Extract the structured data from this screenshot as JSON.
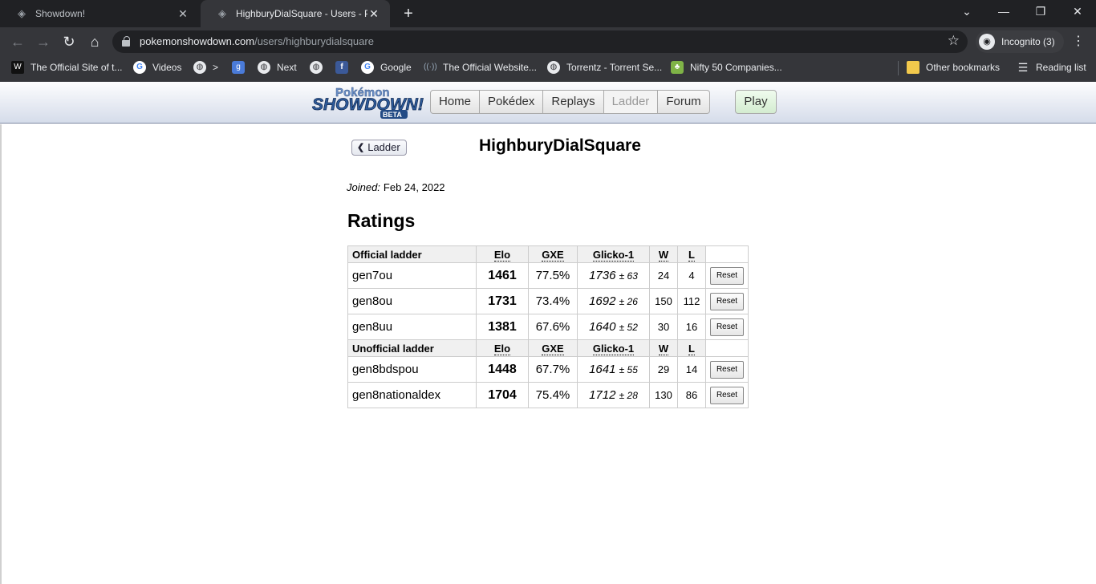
{
  "browser": {
    "tabs": [
      {
        "title": "Showdown!"
      },
      {
        "title": "HighburyDialSquare - Users - Pok"
      }
    ],
    "url_host": "pokemonshowdown.com",
    "url_path": "/users/highburydialsquare",
    "incognito_label": "Incognito (3)",
    "bookmarks": [
      {
        "label": "The Official Site of t...",
        "icon": "wwe-icon"
      },
      {
        "label": "Videos",
        "icon": "google-icon"
      },
      {
        "label": ">",
        "icon": "globe-icon"
      },
      {
        "label": "",
        "icon": "gs-icon"
      },
      {
        "label": "Next",
        "icon": "globe-icon"
      },
      {
        "label": "",
        "icon": "globe-icon"
      },
      {
        "label": "",
        "icon": "facebook-icon"
      },
      {
        "label": "Google",
        "icon": "google-icon"
      },
      {
        "label": "The Official Website...",
        "icon": "broadcast-icon"
      },
      {
        "label": "Torrentz - Torrent Se...",
        "icon": "globe-icon"
      },
      {
        "label": "Nifty 50 Companies...",
        "icon": "nifty-icon"
      }
    ],
    "other_bookmarks": "Other bookmarks",
    "reading_list": "Reading list",
    "accent_dark": "#202124",
    "toolbar_bg": "#35363a"
  },
  "site": {
    "logo_top": "Pokémon",
    "logo_main": "SHOWDOWN!",
    "logo_badge": "BETA",
    "nav": [
      "Home",
      "Pokédex",
      "Replays",
      "Ladder",
      "Forum"
    ],
    "nav_current": "Ladder",
    "play": "Play"
  },
  "profile": {
    "back_label": "Ladder",
    "username": "HighburyDialSquare",
    "joined_label": "Joined:",
    "joined_date": "Feb 24, 2022",
    "ratings_heading": "Ratings",
    "columns": {
      "elo": "Elo",
      "gxe": "GXE",
      "glicko": "Glicko-1",
      "w": "W",
      "l": "L"
    },
    "reset_label": "Reset",
    "sections": [
      {
        "heading": "Official ladder",
        "rows": [
          {
            "format": "gen7ou",
            "elo": "1461",
            "gxe": "77.5%",
            "glicko": "1736",
            "dev": "± 63",
            "w": "24",
            "l": "4"
          },
          {
            "format": "gen8ou",
            "elo": "1731",
            "gxe": "73.4%",
            "glicko": "1692",
            "dev": "± 26",
            "w": "150",
            "l": "112"
          },
          {
            "format": "gen8uu",
            "elo": "1381",
            "gxe": "67.6%",
            "glicko": "1640",
            "dev": "± 52",
            "w": "30",
            "l": "16"
          }
        ]
      },
      {
        "heading": "Unofficial ladder",
        "rows": [
          {
            "format": "gen8bdspou",
            "elo": "1448",
            "gxe": "67.7%",
            "glicko": "1641",
            "dev": "± 55",
            "w": "29",
            "l": "14"
          },
          {
            "format": "gen8nationaldex",
            "elo": "1704",
            "gxe": "75.4%",
            "glicko": "1712",
            "dev": "± 28",
            "w": "130",
            "l": "86"
          }
        ]
      }
    ]
  }
}
